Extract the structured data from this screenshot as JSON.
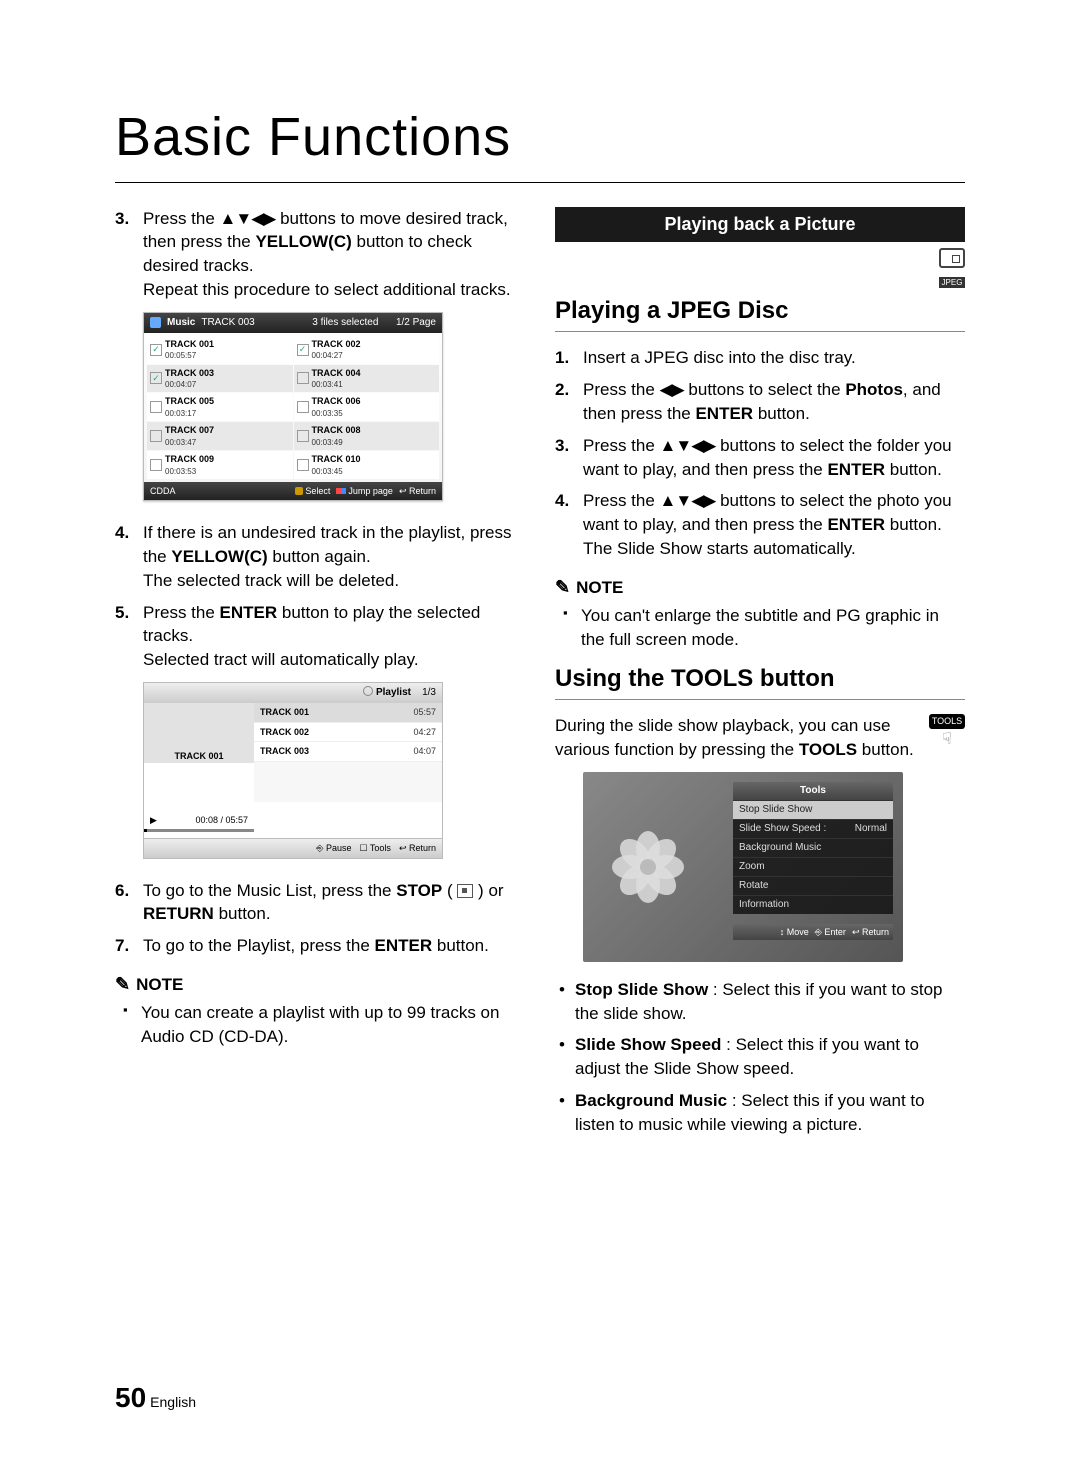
{
  "title": "Basic Functions",
  "page": {
    "num": "50",
    "lang": "English"
  },
  "left": {
    "step3_a": "Press the ",
    "step3_b": " buttons to move desired track, then press the ",
    "step3_c": " button to check desired tracks.",
    "step3_d": "Repeat this procedure to select additional tracks.",
    "yellowc": "YELLOW(C)",
    "step4_a": "If there is an undesired track in the playlist, press the ",
    "step4_b": " button again.",
    "step4_c": "The selected track will be deleted.",
    "step5_a": "Press the ",
    "step5_b": " button to play the selected tracks.",
    "step5_c": "Selected tract will automatically play.",
    "enter": "ENTER",
    "step6_a": "To go to the Music List, press the ",
    "step6_b": " or ",
    "step6_c": " button.",
    "stop": "STOP",
    "return": "RETURN",
    "step7_a": "To go to the Playlist, press the ",
    "step7_b": " button.",
    "note": "NOTE",
    "note1": "You can create a playlist with up to 99 tracks on Audio CD (CD-DA)."
  },
  "panel1": {
    "music": "Music",
    "current": "TRACK 003",
    "sel": "3 files selected",
    "page": "1/2 Page",
    "tracks": [
      {
        "name": "TRACK 001",
        "time": "00:05:57",
        "checked": true
      },
      {
        "name": "TRACK 002",
        "time": "00:04:27",
        "checked": true
      },
      {
        "name": "TRACK 003",
        "time": "00:04:07",
        "checked": true
      },
      {
        "name": "TRACK 004",
        "time": "00:03:41",
        "checked": false
      },
      {
        "name": "TRACK 005",
        "time": "00:03:17",
        "checked": false
      },
      {
        "name": "TRACK 006",
        "time": "00:03:35",
        "checked": false
      },
      {
        "name": "TRACK 007",
        "time": "00:03:47",
        "checked": false
      },
      {
        "name": "TRACK 008",
        "time": "00:03:49",
        "checked": false
      },
      {
        "name": "TRACK 009",
        "time": "00:03:53",
        "checked": false
      },
      {
        "name": "TRACK 010",
        "time": "00:03:45",
        "checked": false
      }
    ],
    "cdda": "CDDA",
    "select": "Select",
    "jump": "Jump page",
    "ret": "Return"
  },
  "panel2": {
    "playlist": "Playlist",
    "page": "1/3",
    "art": "TRACK 001",
    "time": "00:08 / 05:57",
    "rows": [
      {
        "name": "TRACK 001",
        "time": "05:57"
      },
      {
        "name": "TRACK 002",
        "time": "04:27"
      },
      {
        "name": "TRACK 003",
        "time": "04:07"
      }
    ],
    "pause": "Pause",
    "tools": "Tools",
    "ret": "Return"
  },
  "right": {
    "bar": "Playing back a Picture",
    "jpeg": "JPEG",
    "h2a": "Playing a JPEG Disc",
    "s1": "Insert a JPEG disc into the disc tray.",
    "s2a": "Press the ",
    "s2b": " buttons to select the ",
    "s2c": ", and then press the ",
    "s2d": " button.",
    "photos": "Photos",
    "enter": "ENTER",
    "s3a": "Press the ",
    "s3b": " buttons to select the folder you want to play, and then press the ",
    "s3c": " button.",
    "s4a": "Press the ",
    "s4b": " buttons to select the photo you want to play, and then press the ",
    "s4c": " button.",
    "s4d": "The Slide Show starts automatically.",
    "note": "NOTE",
    "note1": "You can't enlarge the subtitle and PG graphic in the full screen mode.",
    "h2b": "Using the TOOLS button",
    "tb1": "During the slide show playback, you can use various function by pressing the ",
    "tb2": " button.",
    "tools": "TOOLS",
    "menu": {
      "title": "Tools",
      "items": [
        "Stop Slide Show",
        "Slide Show Speed :",
        "Background Music",
        "Zoom",
        "Rotate",
        "Information"
      ],
      "normal": "Normal",
      "move": "Move",
      "enter": "Enter",
      "ret": "Return"
    },
    "b1a": "Stop Slide Show",
    "b1b": " : Select this if you want to stop the slide show.",
    "b2a": "Slide Show Speed",
    "b2b": " : Select this if you want to adjust the Slide Show speed.",
    "b3a": "Background Music",
    "b3b": " : Select this if you want to listen to music while viewing a picture."
  }
}
